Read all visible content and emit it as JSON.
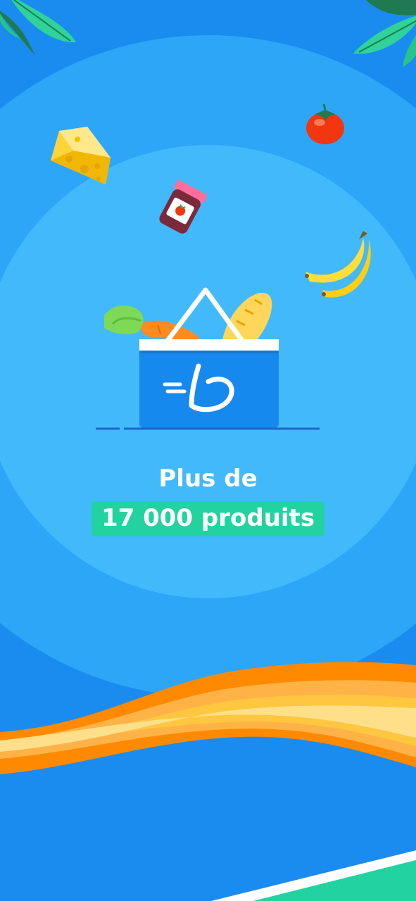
{
  "onboarding": {
    "headline_line1": "Plus de",
    "headline_highlight": "17 000 produits"
  },
  "illustration": {
    "icons": [
      "leaf-icon",
      "cheese-icon",
      "tomato-icon",
      "jam-jar-icon",
      "banana-icon",
      "carrot-icon",
      "baguette-icon",
      "basket-icon",
      "brand-logo-icon"
    ]
  },
  "colors": {
    "background": "#1a8cf0",
    "circle_outer": "#2ea6f7",
    "circle_inner": "#42b9fb",
    "highlight": "#22d3a0",
    "basket": "#1689ee",
    "wave_orange": "#ff8a00",
    "wave_yellow": "#ffc640"
  }
}
